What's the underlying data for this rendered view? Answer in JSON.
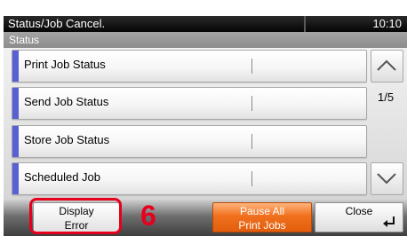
{
  "title_bar": {
    "title": "Status/Job Cancel.",
    "time": "10:10"
  },
  "status_header": {
    "label": "Status"
  },
  "menu_items": [
    {
      "label": "Print Job Status"
    },
    {
      "label": "Send Job Status"
    },
    {
      "label": "Store Job Status"
    },
    {
      "label": "Scheduled Job"
    }
  ],
  "pagination": {
    "indicator": "1/5",
    "up_icon": "chevron-up-icon",
    "down_icon": "chevron-down-icon"
  },
  "bottom_bar": {
    "display_error": {
      "line1": "Display",
      "line2": "Error"
    },
    "pause_all": {
      "line1": "Pause All",
      "line2": "Print Jobs"
    },
    "close": {
      "label": "Close",
      "icon": "enter-return-icon"
    }
  },
  "annotation": {
    "step_number": "6"
  },
  "colors": {
    "accent_bar": "#5860d2",
    "highlight_red": "#e6001e",
    "pause_orange": "#f0701d",
    "title_bg": "#111111",
    "status_bg": "#999999"
  }
}
